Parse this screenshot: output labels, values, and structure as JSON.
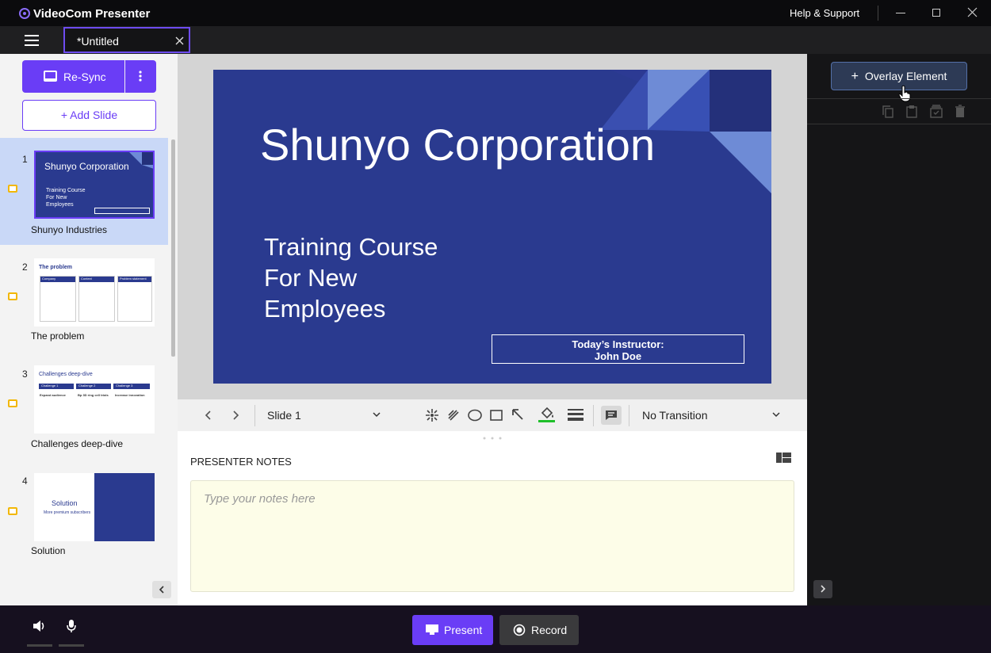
{
  "app": {
    "title": "VideoCom Presenter",
    "help": "Help & Support"
  },
  "tab": {
    "label": "*Untitled"
  },
  "left": {
    "resync_label": "Re-Sync",
    "add_slide_label": "+ Add Slide",
    "slides": [
      {
        "num": "1",
        "title": "Shunyo Industries"
      },
      {
        "num": "2",
        "title": "The problem"
      },
      {
        "num": "3",
        "title": "Challenges deep-dive"
      },
      {
        "num": "4",
        "title": "Solution"
      }
    ]
  },
  "thumbs": {
    "t1": {
      "title": "Shunyo Corporation",
      "sub": "Training Course\nFor New\nEmployees"
    },
    "t2": {
      "title": "The problem",
      "cols": [
        "Company",
        "Context",
        "Problem statement"
      ]
    },
    "t3": {
      "title": "Challenges deep-dive",
      "cols": [
        "Challenge 1",
        "Challenge 2",
        "Challenge 3"
      ],
      "heads": [
        "Expand audience",
        "Bp 3D ring cell trials",
        "Increase innovation"
      ]
    },
    "t4": {
      "title": "Solution",
      "sub": "More premium subscribers"
    }
  },
  "slide": {
    "title": "Shunyo Corporation",
    "sub1": "Training Course",
    "sub2": "For New",
    "sub3": "Employees",
    "instructor1": "Today’s Instructor:",
    "instructor2": "John Doe"
  },
  "toolbar": {
    "slide_select": "Slide 1",
    "transition": "No Transition"
  },
  "notes": {
    "label": "PRESENTER NOTES",
    "placeholder": "Type your notes here"
  },
  "right": {
    "overlay_label": "Overlay Element"
  },
  "bottom": {
    "present_label": "Present",
    "record_label": "Record"
  },
  "colors": {
    "accent": "#6a3df6",
    "slide_bg": "#2a3a8f",
    "selected_slide": "#c9d8f7"
  }
}
